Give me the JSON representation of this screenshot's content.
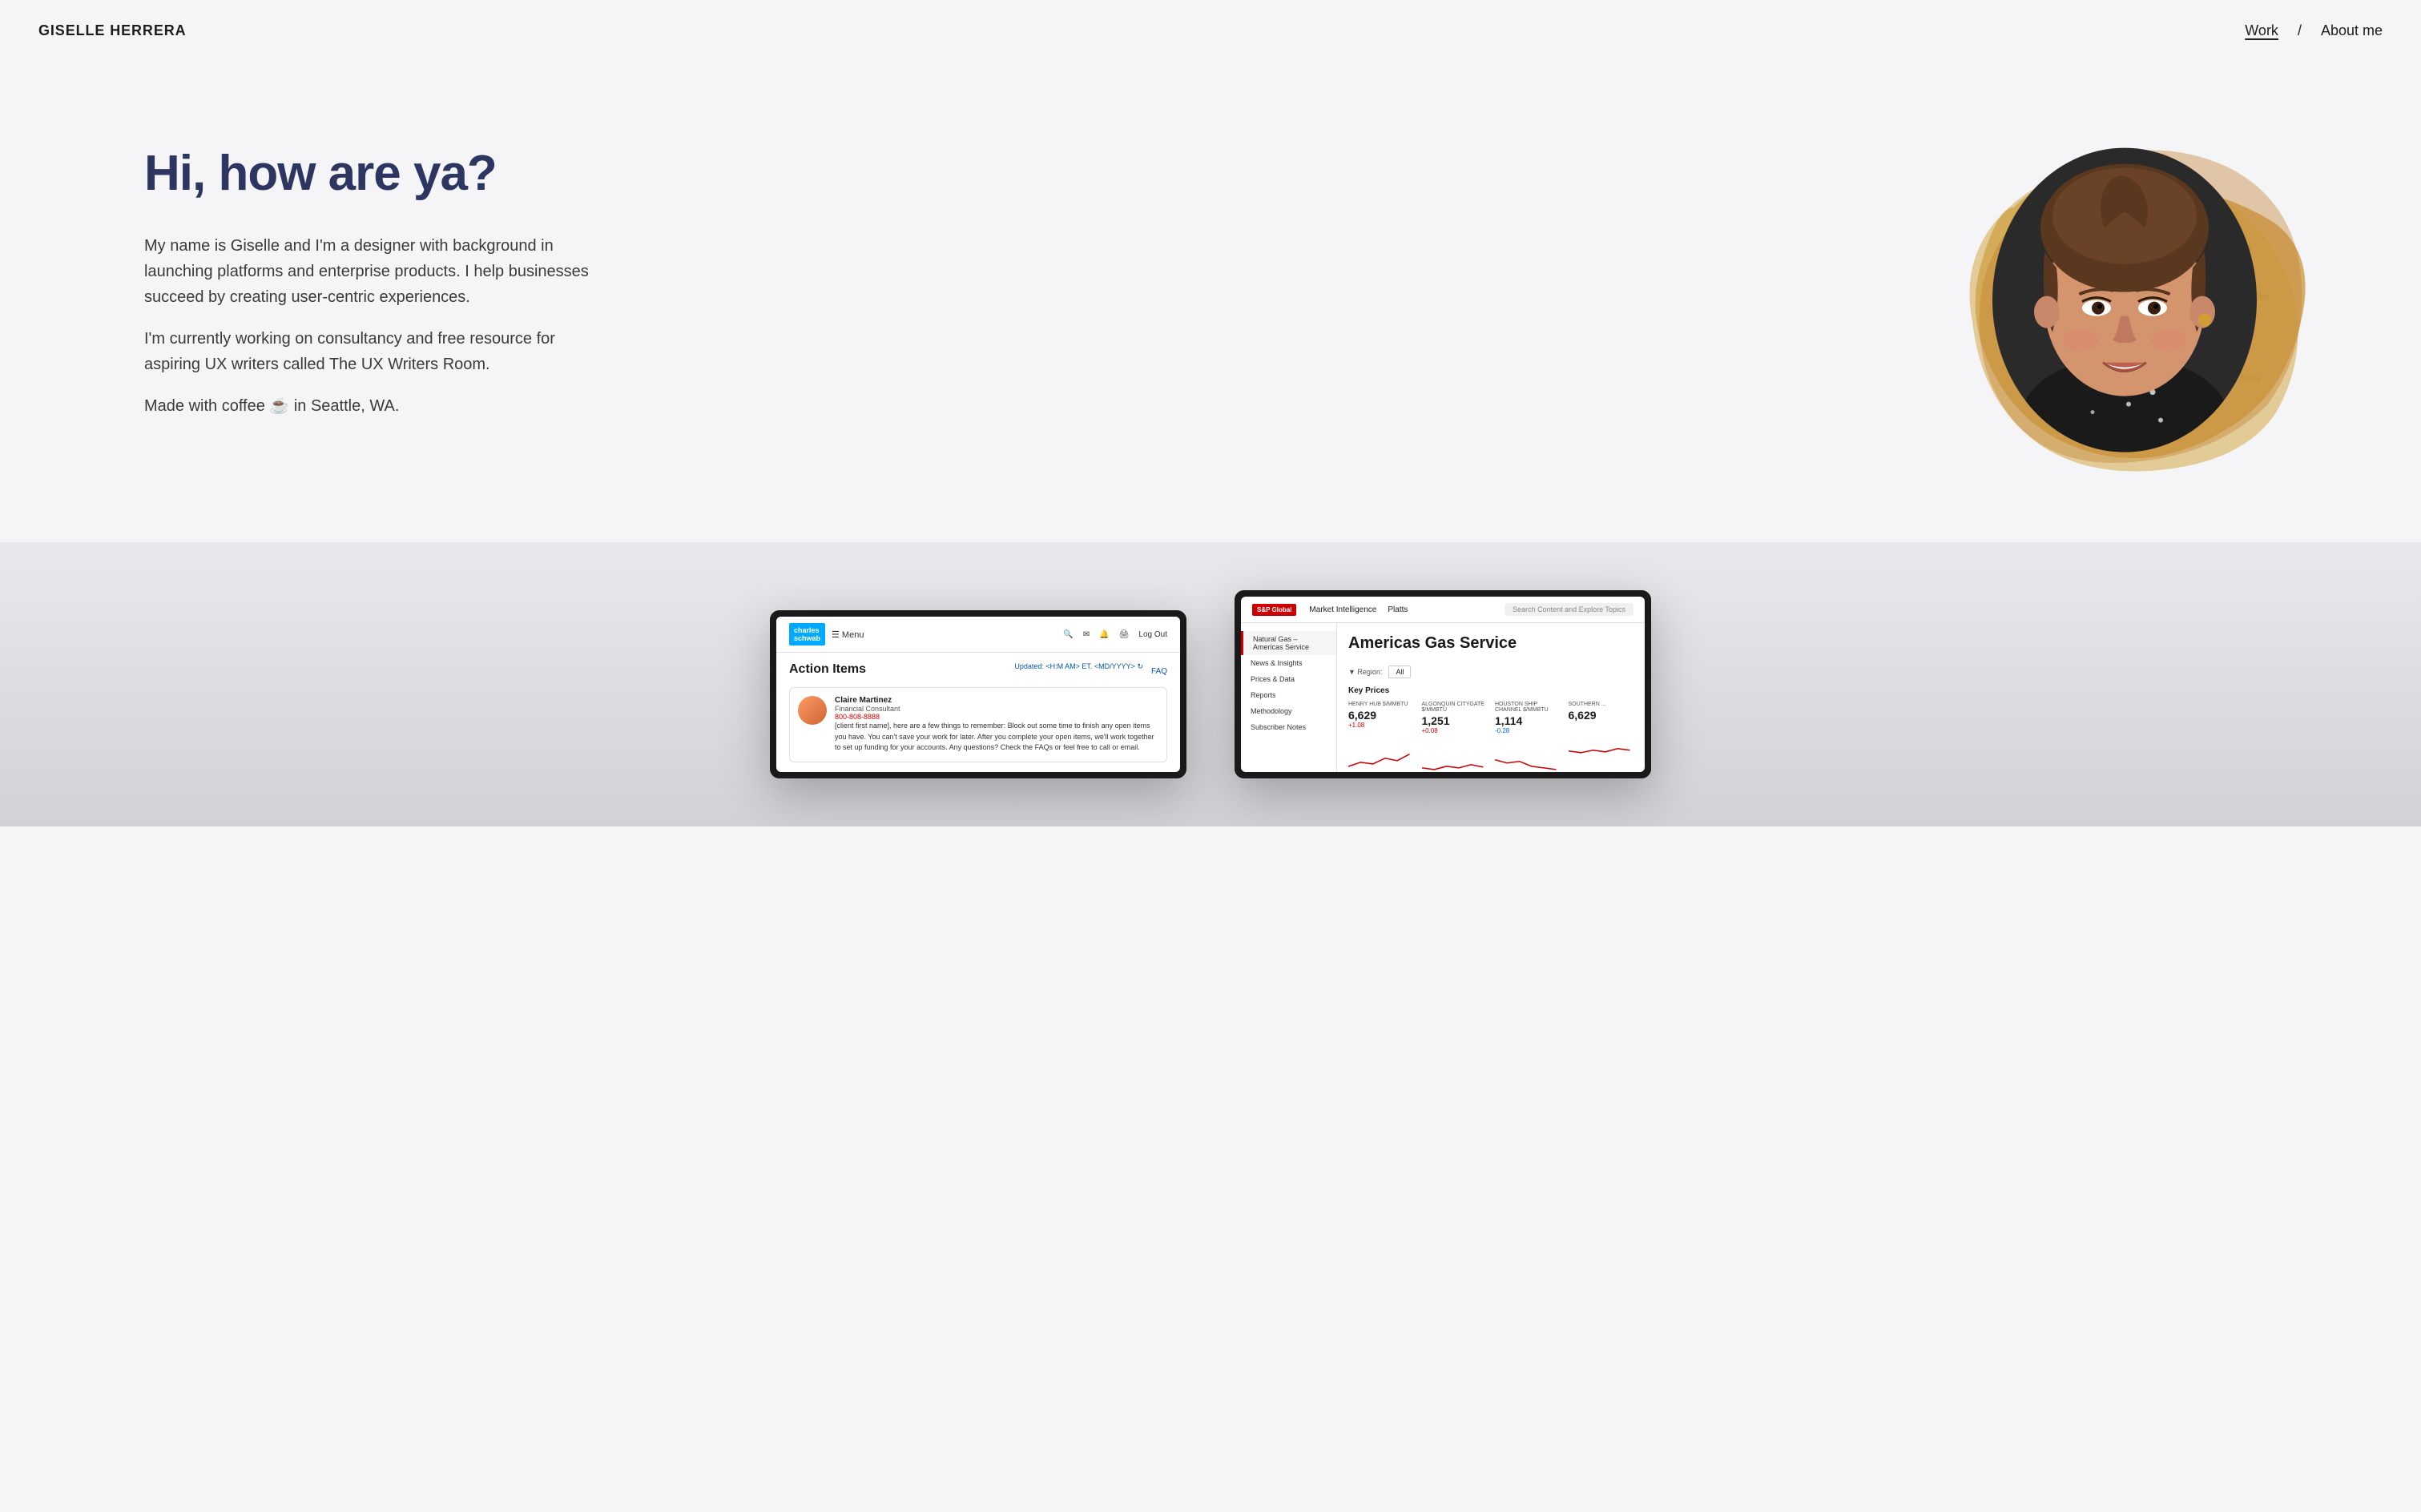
{
  "header": {
    "logo": "GISELLE HERRERA",
    "nav": {
      "work": "Work",
      "divider": "/",
      "about": "About me"
    }
  },
  "hero": {
    "heading": "Hi, how are ya?",
    "body1": "My name is Giselle and I'm a designer with background in launching platforms and enterprise products. I help businesses succeed by creating user-centric experiences.",
    "body2": "I'm currently working on consultancy and free resource for aspiring UX writers called The UX Writers Room.",
    "body3": "Made with coffee ☕ in Seattle, WA."
  },
  "portfolio": {
    "item1": {
      "company": "Charles Schwab",
      "title": "Action Items",
      "updated_label": "Updated: <H:M AM> ET. <MD/YYYY>",
      "faq": "FAQ",
      "contact_name": "Claire Martinez",
      "contact_title": "Financial Consultant",
      "contact_phone": "800-808-8888",
      "message": "[client first name], here are a few things to remember: Block out some time to finish any open items you have. You can't save your work for later. After you complete your open items, we'll work together to set up funding for your accounts. Any questions? Check the FAQs or feel free to call or email."
    },
    "item2": {
      "company": "S&P Global",
      "logo_text": "S&P Global",
      "nav1": "Market Intelligence",
      "nav2": "Platts",
      "search_placeholder": "Search Content and Explore Topics",
      "title": "Americas Gas Service",
      "sidebar_items": [
        "Natural Gas – Americas Service",
        "News & Insights",
        "Prices & Data",
        "Reports",
        "Methodology",
        "Subscriber Notes"
      ],
      "region_label": "Region:",
      "region_value": "All",
      "section_title": "Key Prices",
      "prices": [
        {
          "hub": "HENRY HUB $/MMBTU",
          "value": "6,629",
          "change": "+1.08"
        },
        {
          "hub": "ALGONQUIN CITYGATE $/MMBTU",
          "value": "1,251",
          "change": "+0.08"
        },
        {
          "hub": "HOUSTON SHIP CHANNEL $/MMBTU",
          "value": "1,114",
          "change": "-0.28"
        },
        {
          "hub": "SOUTHERN ...",
          "value": "6,629",
          "change": ""
        }
      ]
    }
  }
}
